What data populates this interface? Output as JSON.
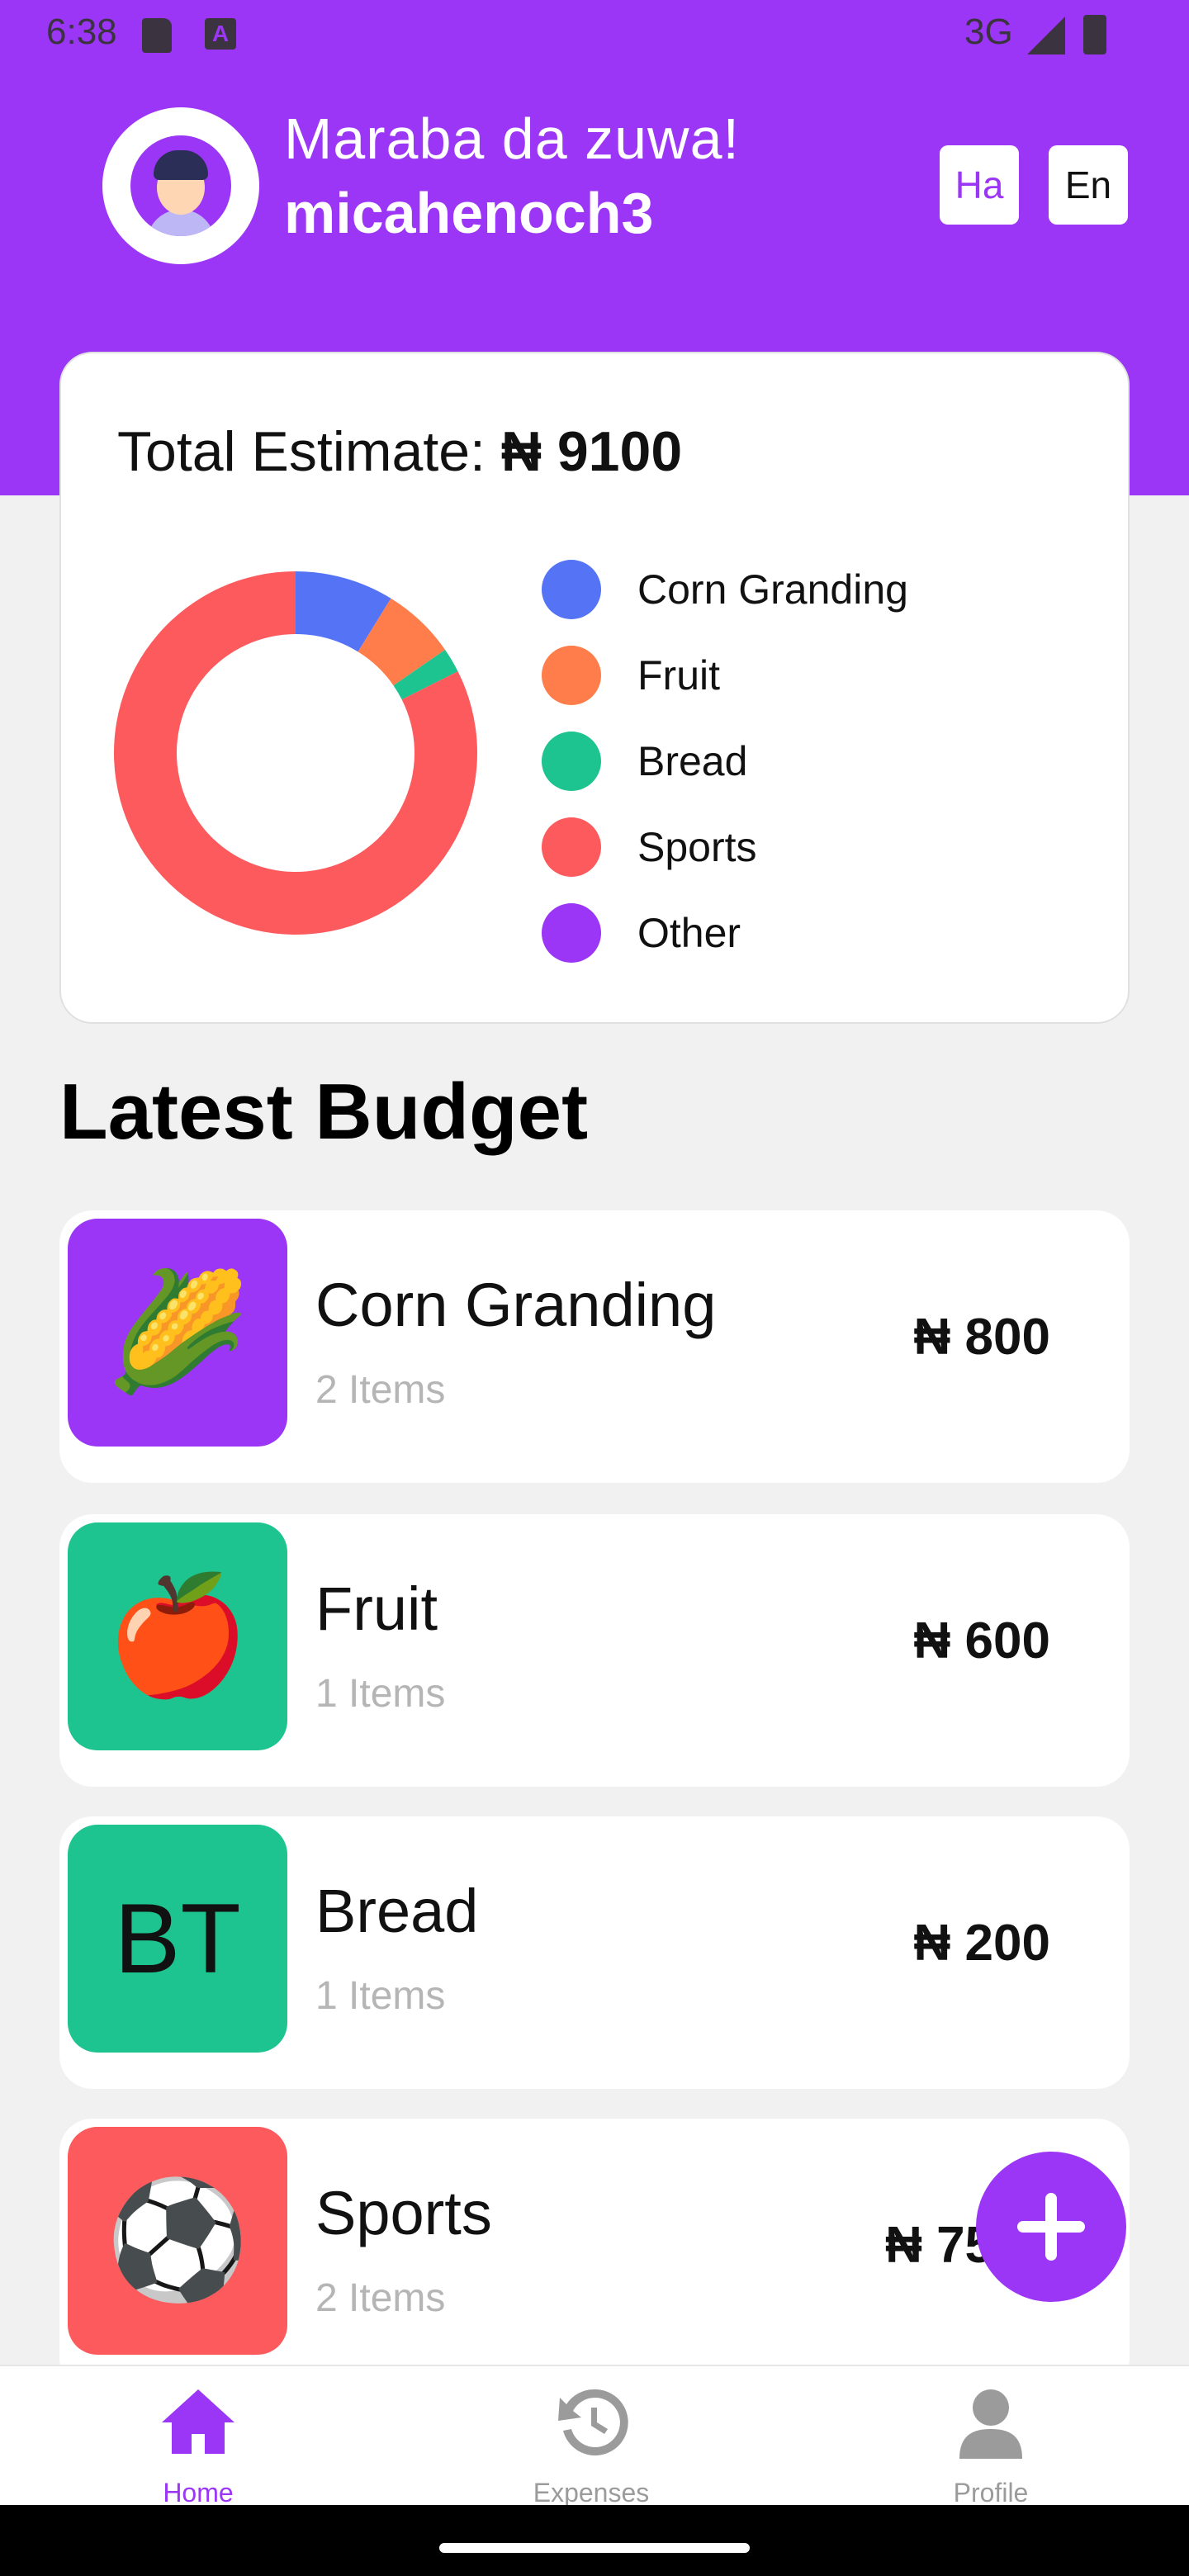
{
  "status_bar": {
    "time": "6:38",
    "network": "3G"
  },
  "header": {
    "greeting": "Maraba da zuwa!",
    "username": "micahenoch3",
    "lang_ha": "Ha",
    "lang_en": "En"
  },
  "estimate": {
    "label": "Total Estimate:",
    "amount": "₦ 9100",
    "legend": [
      {
        "label": "Corn Granding",
        "color": "#5474f5"
      },
      {
        "label": "Fruit",
        "color": "#fe7d4b"
      },
      {
        "label": "Bread",
        "color": "#1dc48f"
      },
      {
        "label": "Sports",
        "color": "#fd5a5d"
      },
      {
        "label": "Other",
        "color": "#9b36f6"
      }
    ]
  },
  "chart_data": {
    "type": "pie",
    "categories": [
      "Corn Granding",
      "Fruit",
      "Bread",
      "Sports",
      "Other"
    ],
    "values": [
      800,
      600,
      200,
      7500,
      0
    ],
    "colors": [
      "#5474f5",
      "#fe7d4b",
      "#1dc48f",
      "#fd5a5d",
      "#9b36f6"
    ]
  },
  "latest_budget": {
    "title": "Latest Budget",
    "items": [
      {
        "name": "Corn Granding",
        "count": "2 Items",
        "amount": "₦ 800",
        "icon": "🌽",
        "color": "#9b36f6"
      },
      {
        "name": "Fruit",
        "count": "1 Items",
        "amount": "₦ 600",
        "icon": "🍎",
        "color": "#1dc48f"
      },
      {
        "name": "Bread",
        "count": "1 Items",
        "amount": "₦ 200",
        "icon": "BT",
        "color": "#1dc48f"
      },
      {
        "name": "Sports",
        "count": "2 Items",
        "amount": "₦ 7500",
        "icon": "⚽",
        "color": "#fd5a5d"
      }
    ]
  },
  "nav": {
    "home": "Home",
    "expenses": "Expenses",
    "profile": "Profile"
  },
  "colors": {
    "primary": "#9b36f6"
  }
}
